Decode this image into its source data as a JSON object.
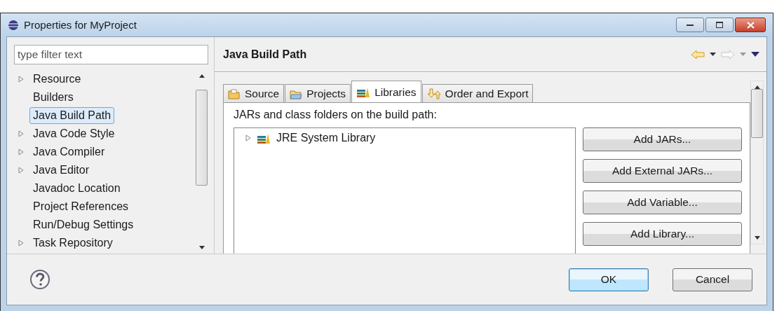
{
  "window": {
    "title": "Properties for MyProject"
  },
  "filter": {
    "placeholder": "type filter text"
  },
  "nav_tree": [
    {
      "label": "Resource",
      "expandable": true,
      "selected": false
    },
    {
      "label": "Builders",
      "expandable": false,
      "selected": false
    },
    {
      "label": "Java Build Path",
      "expandable": false,
      "selected": true
    },
    {
      "label": "Java Code Style",
      "expandable": true,
      "selected": false
    },
    {
      "label": "Java Compiler",
      "expandable": true,
      "selected": false
    },
    {
      "label": "Java Editor",
      "expandable": true,
      "selected": false
    },
    {
      "label": "Javadoc Location",
      "expandable": false,
      "selected": false
    },
    {
      "label": "Project References",
      "expandable": false,
      "selected": false
    },
    {
      "label": "Run/Debug Settings",
      "expandable": false,
      "selected": false
    },
    {
      "label": "Task Repository",
      "expandable": true,
      "selected": false
    }
  ],
  "page": {
    "title": "Java Build Path"
  },
  "tabs": [
    {
      "label": "Source",
      "kind": "source",
      "selected": false
    },
    {
      "label": "Projects",
      "kind": "projects",
      "selected": false
    },
    {
      "label": "Libraries",
      "kind": "libraries",
      "selected": true
    },
    {
      "label": "Order and Export",
      "kind": "order",
      "selected": false
    }
  ],
  "libraries_panel": {
    "caption": "JARs and class folders on the build path:",
    "entries": [
      {
        "label": "JRE System Library",
        "expanded": false
      }
    ],
    "buttons": [
      "Add JARs...",
      "Add External JARs...",
      "Add Variable...",
      "Add Library..."
    ]
  },
  "buttons": [
    "OK",
    "Cancel"
  ]
}
